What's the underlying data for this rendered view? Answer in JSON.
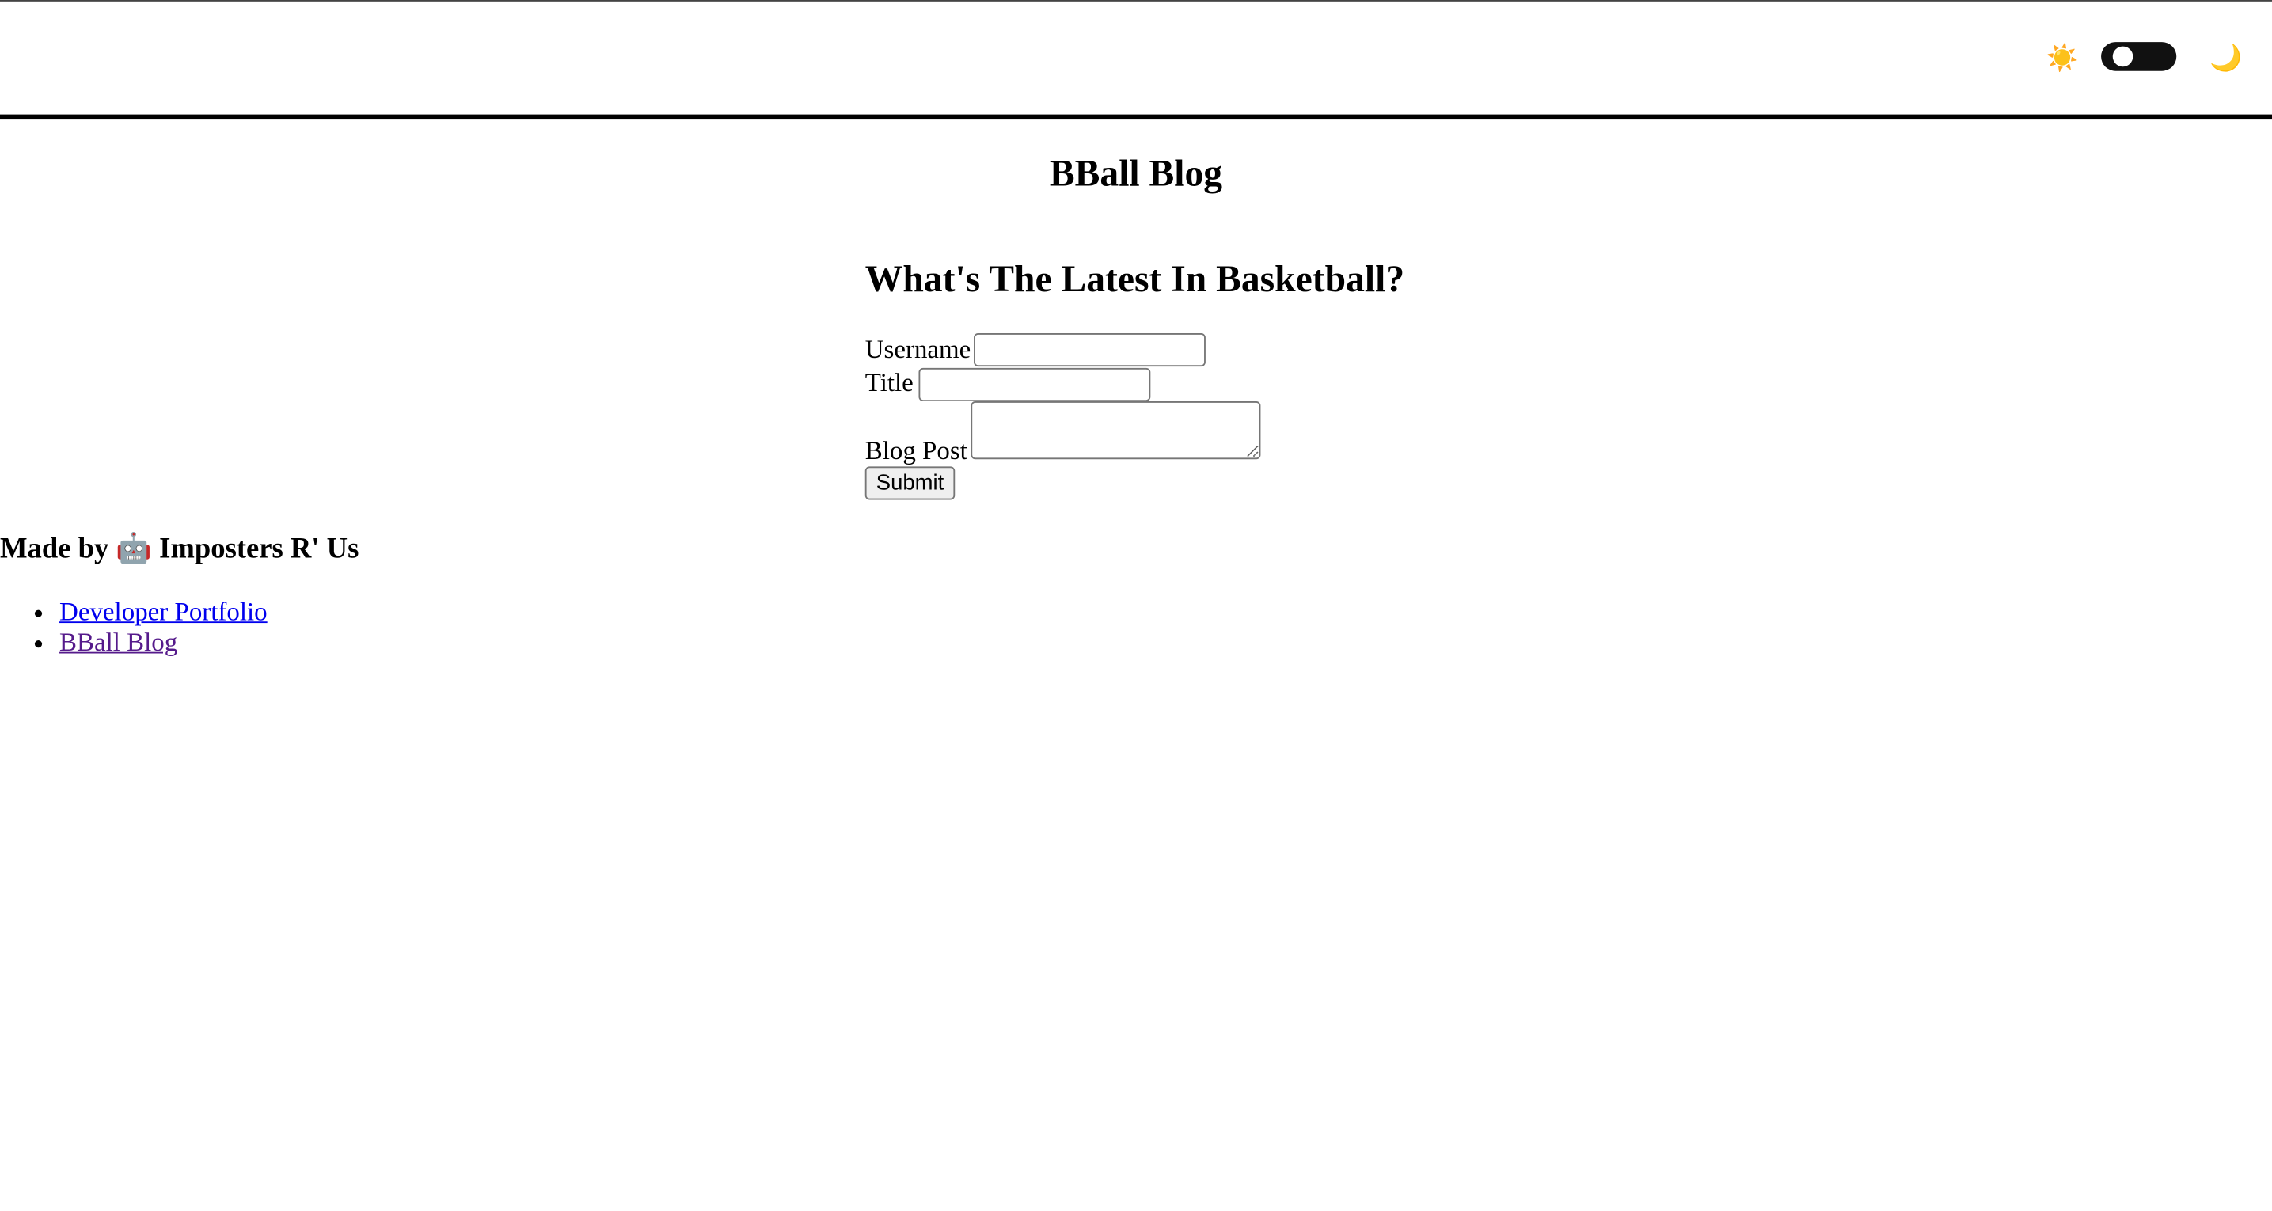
{
  "header": {
    "sun_icon": "☀️",
    "moon_icon": "🌙",
    "theme_toggle": {
      "state": "light"
    }
  },
  "site_title": "BBall Blog",
  "main": {
    "heading": "What's The Latest In Basketball?",
    "form": {
      "username_label": "Username",
      "username_value": "",
      "title_label": "Title",
      "title_value": "",
      "blog_post_label": "Blog Post",
      "blog_post_value": "",
      "submit_label": "Submit"
    }
  },
  "footer": {
    "credit_prefix": "Made by",
    "credit_icon": "🤖",
    "credit_name": "Imposters R' Us",
    "links": [
      {
        "label": "Developer Portfolio",
        "color": "#0000ee"
      },
      {
        "label": "BBall Blog",
        "color": "#551a8b"
      }
    ]
  }
}
